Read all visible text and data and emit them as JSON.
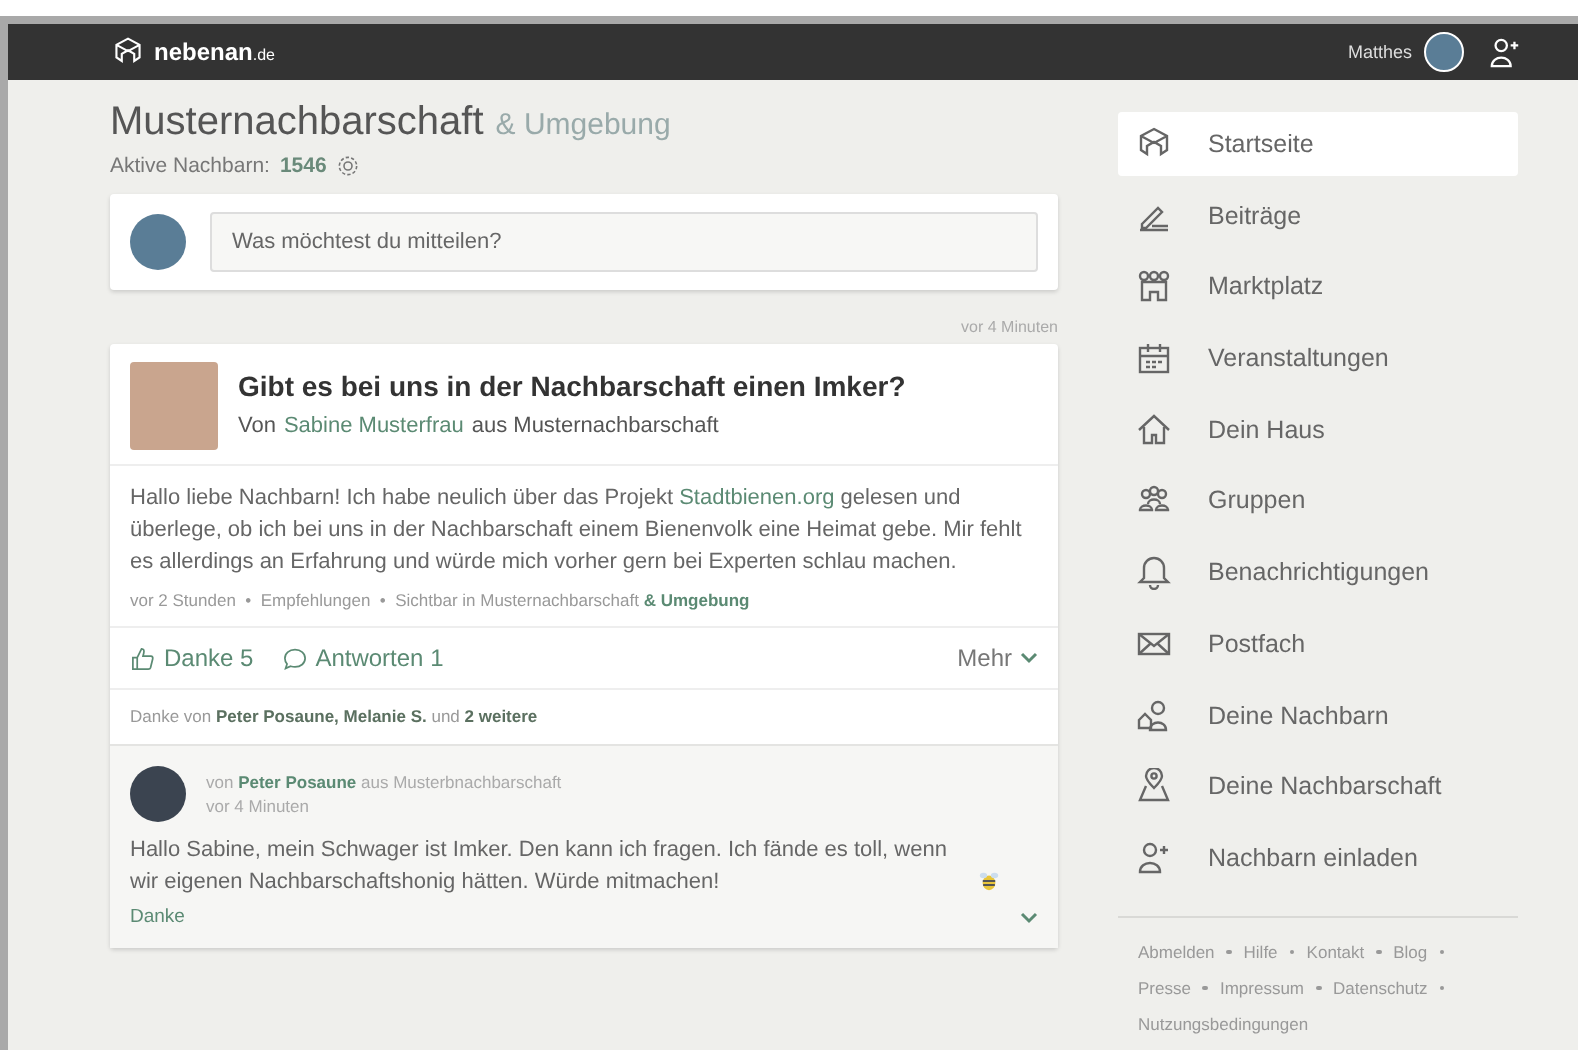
{
  "topbar": {
    "logo": "nebenan",
    "logo_suffix": ".de",
    "user": "Matthes"
  },
  "header": {
    "title": "Musternachbarschaft",
    "title_suffix": "& Umgebung",
    "active_label": "Aktive Nachbarn:",
    "active_count": "1546"
  },
  "composer": {
    "placeholder": "Was möchtest du mitteilen?"
  },
  "post": {
    "time_top": "vor 4 Minuten",
    "title": "Gibt es bei uns in der Nachbarschaft einen Imker?",
    "by": "Von",
    "author": "Sabine Musterfrau",
    "from": "aus Musternachbarschaft",
    "body_before": "Hallo liebe Nachbarn! Ich habe neulich über das Projekt",
    "body_link": "Stadtbienen.org",
    "body_after": "gelesen und überlege, ob ich bei uns in der Nachbarschaft einem Bienenvolk eine Heimat gebe. Mir fehlt es allerdings an Erfahrung und würde mich vorher gern bei Experten schlau machen.",
    "meta": "vor 2 Stunden  •  Empfehlungen  •  Sichtbar in Musternachbarschaft **& Umgebung**",
    "thanks": "Danke 5",
    "replies": "Antworten 1",
    "more": "Mehr",
    "thanked_by": "Danke von **Peter Posaune, Melanie S.** und **2 weitere**"
  },
  "reply": {
    "author_line": "von **Peter Posaune** aus Musterbnachbarschaft",
    "time": "vor 4 Minuten",
    "text": "Hallo Sabine, mein Schwager ist Imker. Den kann ich fragen. Ich fände es toll, wenn wir eigenen Nachbarschaftshonig hätten. Würde mitmachen!",
    "thanks": "Danke"
  },
  "sidebar": {
    "items": [
      {
        "label": "Startseite",
        "selected": true
      },
      {
        "label": "Beiträge",
        "selected": false
      },
      {
        "label": "Marktplatz",
        "selected": false
      },
      {
        "label": "Veranstaltungen",
        "selected": false
      },
      {
        "label": "Dein Haus",
        "selected": false
      },
      {
        "label": "Gruppen",
        "selected": false
      },
      {
        "label": "Benachrichtigungen",
        "selected": false
      },
      {
        "label": "Postfach",
        "selected": false
      },
      {
        "label": "Deine Nachbarn",
        "selected": false
      },
      {
        "label": "Deine Nachbarschaft",
        "selected": false
      },
      {
        "label": "Nachbarn einladen",
        "selected": false
      }
    ],
    "footer_links": [
      "Abmelden",
      "Hilfe",
      "Kontakt",
      "Blog",
      "Presse",
      "Impressum",
      "Datenschutz",
      "Nutzungsbedingungen"
    ]
  }
}
